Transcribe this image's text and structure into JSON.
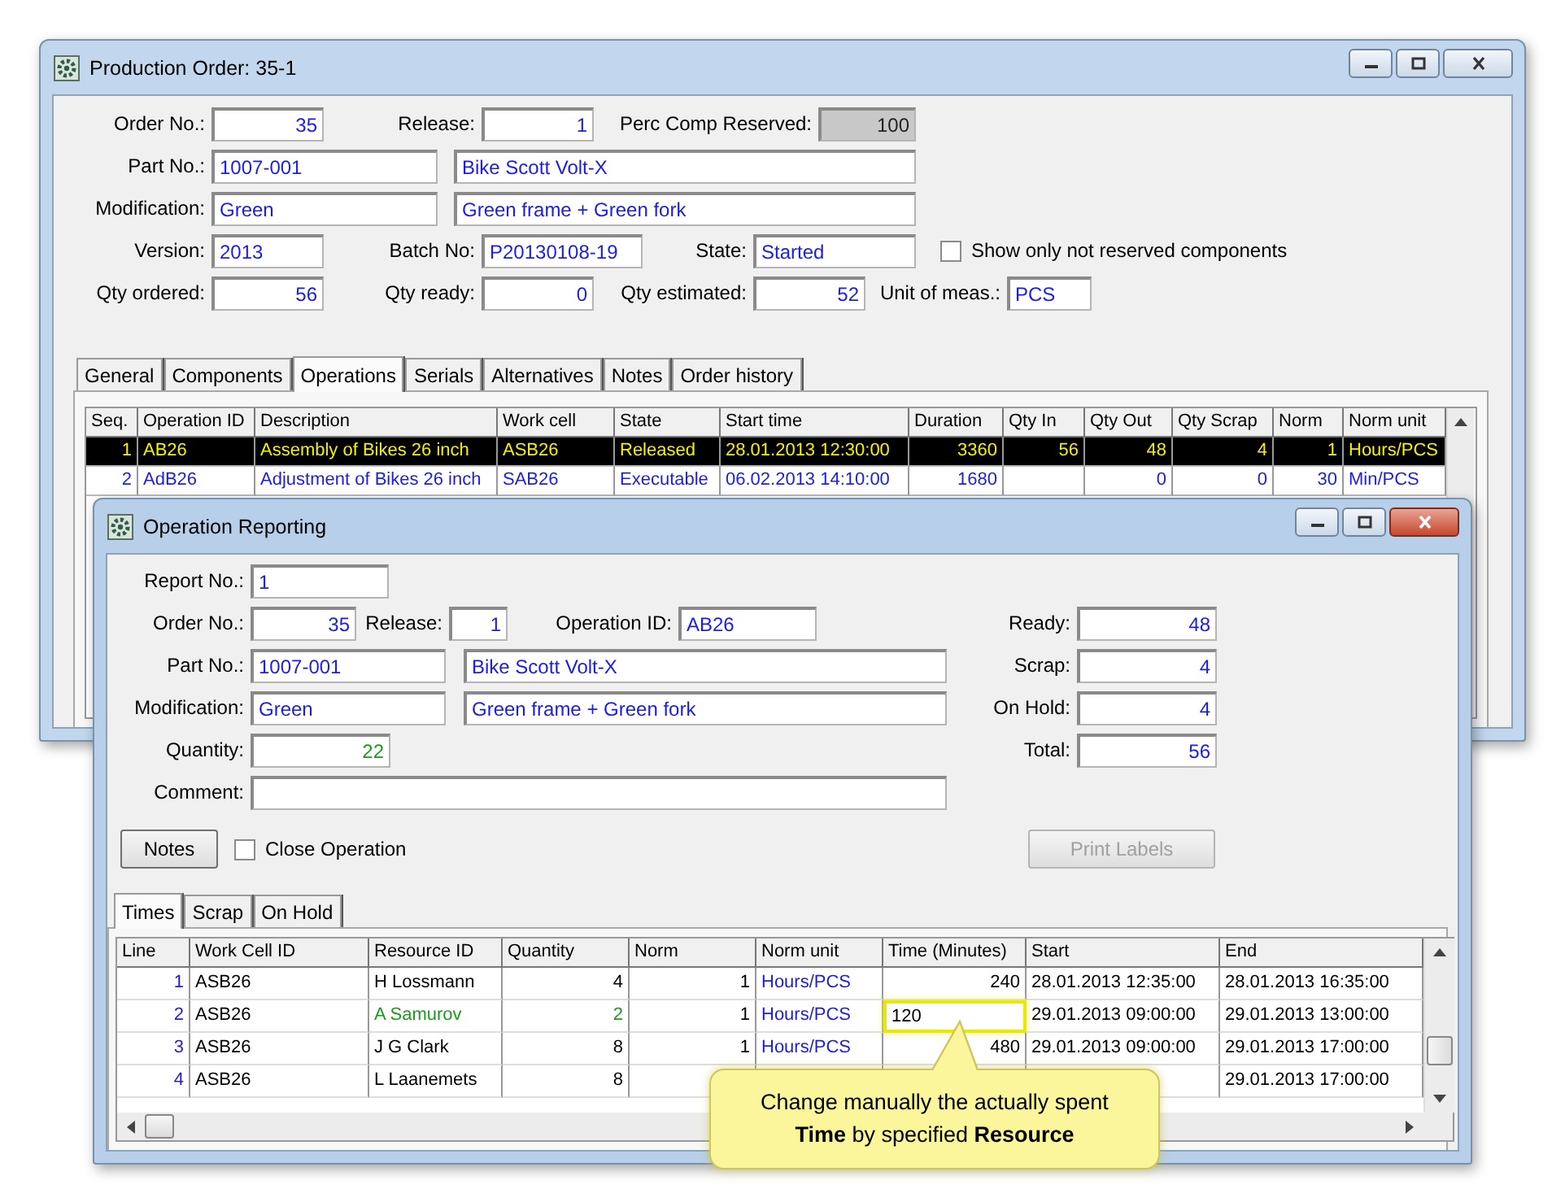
{
  "production_order": {
    "title": "Production Order: 35-1",
    "order_no": {
      "label": "Order No.:",
      "value": "35"
    },
    "release": {
      "label": "Release:",
      "value": "1"
    },
    "perc_comp_reserved": {
      "label": "Perc Comp Reserved:",
      "value": "100",
      "disabled": true
    },
    "part_no": {
      "label": "Part No.:",
      "value": "1007-001",
      "description": "Bike Scott Volt-X"
    },
    "modification": {
      "label": "Modification:",
      "value": "Green",
      "description": "Green frame + Green fork"
    },
    "version": {
      "label": "Version:",
      "value": "2013"
    },
    "batch_no": {
      "label": "Batch No:",
      "value": "P20130108-19"
    },
    "state": {
      "label": "State:",
      "value": "Started"
    },
    "show_only_not_reserved": {
      "label": "Show only not reserved components",
      "checked": false
    },
    "qty_ordered": {
      "label": "Qty ordered:",
      "value": "56"
    },
    "qty_ready": {
      "label": "Qty ready:",
      "value": "0"
    },
    "qty_estimated": {
      "label": "Qty estimated:",
      "value": "52"
    },
    "unit_of_meas": {
      "label": "Unit of meas.:",
      "value": "PCS"
    },
    "tabs": [
      {
        "label": "General",
        "selected": false
      },
      {
        "label": "Components",
        "selected": false
      },
      {
        "label": "Operations",
        "selected": true
      },
      {
        "label": "Serials",
        "selected": false
      },
      {
        "label": "Alternatives",
        "selected": false
      },
      {
        "label": "Notes",
        "selected": false
      },
      {
        "label": "Order history",
        "selected": false
      }
    ],
    "operations": {
      "columns": [
        "Seq.",
        "Operation ID",
        "Description",
        "Work cell",
        "State",
        "Start time",
        "Duration",
        "Qty In",
        "Qty Out",
        "Qty Scrap",
        "Norm",
        "Norm unit"
      ],
      "rows": [
        {
          "selected": true,
          "cells": [
            "1",
            "AB26",
            "Assembly of Bikes 26 inch",
            "ASB26",
            "Released",
            "28.01.2013 12:30:00",
            "3360",
            "56",
            "48",
            "4",
            "1",
            "Hours/PCS"
          ]
        },
        {
          "selected": false,
          "cells": [
            "2",
            "AdB26",
            "Adjustment of Bikes 26 inch",
            "SAB26",
            "Executable",
            "06.02.2013 14:10:00",
            "1680",
            null,
            "0",
            "0",
            "30",
            "Min/PCS"
          ]
        }
      ]
    }
  },
  "operation_reporting": {
    "title": "Operation Reporting",
    "report_no": {
      "label": "Report No.:",
      "value": "1"
    },
    "order_no": {
      "label": "Order No.:",
      "value": "35"
    },
    "release": {
      "label": "Release:",
      "value": "1"
    },
    "operation_id": {
      "label": "Operation ID:",
      "value": "AB26"
    },
    "part_no": {
      "label": "Part No.:",
      "value": "1007-001",
      "description": "Bike Scott Volt-X"
    },
    "modification": {
      "label": "Modification:",
      "value": "Green",
      "description": "Green frame + Green fork"
    },
    "quantity": {
      "label": "Quantity:",
      "value": "22"
    },
    "comment": {
      "label": "Comment:"
    },
    "ready": {
      "label": "Ready:",
      "value": "48"
    },
    "scrap": {
      "label": "Scrap:",
      "value": "4"
    },
    "on_hold": {
      "label": "On Hold:",
      "value": "4"
    },
    "total": {
      "label": "Total:",
      "value": "56"
    },
    "notes_button": "Notes",
    "close_operation": {
      "label": "Close Operation",
      "checked": false
    },
    "print_labels": {
      "label": "Print Labels",
      "disabled": true
    },
    "tabs": [
      {
        "label": "Times",
        "selected": true
      },
      {
        "label": "Scrap",
        "selected": false
      },
      {
        "label": "On Hold",
        "selected": false
      }
    ],
    "times": {
      "columns": [
        "Line",
        "Work Cell ID",
        "Resource ID",
        "Quantity",
        "Norm",
        "Norm unit",
        "Time (Minutes)",
        "Start",
        "End"
      ],
      "rows": [
        {
          "selected": false,
          "editing": false,
          "cells": [
            "1",
            "ASB26",
            "H Lossmann",
            "4",
            "1",
            "Hours/PCS",
            "240",
            "28.01.2013 12:35:00",
            "28.01.2013 16:35:00"
          ]
        },
        {
          "selected": true,
          "editing": true,
          "cells": [
            "2",
            "ASB26",
            "A Samurov",
            "2",
            "1",
            "Hours/PCS",
            "120",
            "29.01.2013 09:00:00",
            "29.01.2013 13:00:00"
          ]
        },
        {
          "selected": false,
          "editing": false,
          "cells": [
            "3",
            "ASB26",
            "J G Clark",
            "8",
            "1",
            "Hours/PCS",
            "480",
            "29.01.2013 09:00:00",
            "29.01.2013 17:00:00"
          ]
        },
        {
          "selected": false,
          "editing": false,
          "cells": [
            "4",
            "ASB26",
            "L Laanemets",
            "8",
            null,
            null,
            null,
            null,
            "29.01.2013 17:00:00"
          ]
        }
      ]
    },
    "callout": "Change manually the actually spent **Time** by specified **Resource**"
  }
}
